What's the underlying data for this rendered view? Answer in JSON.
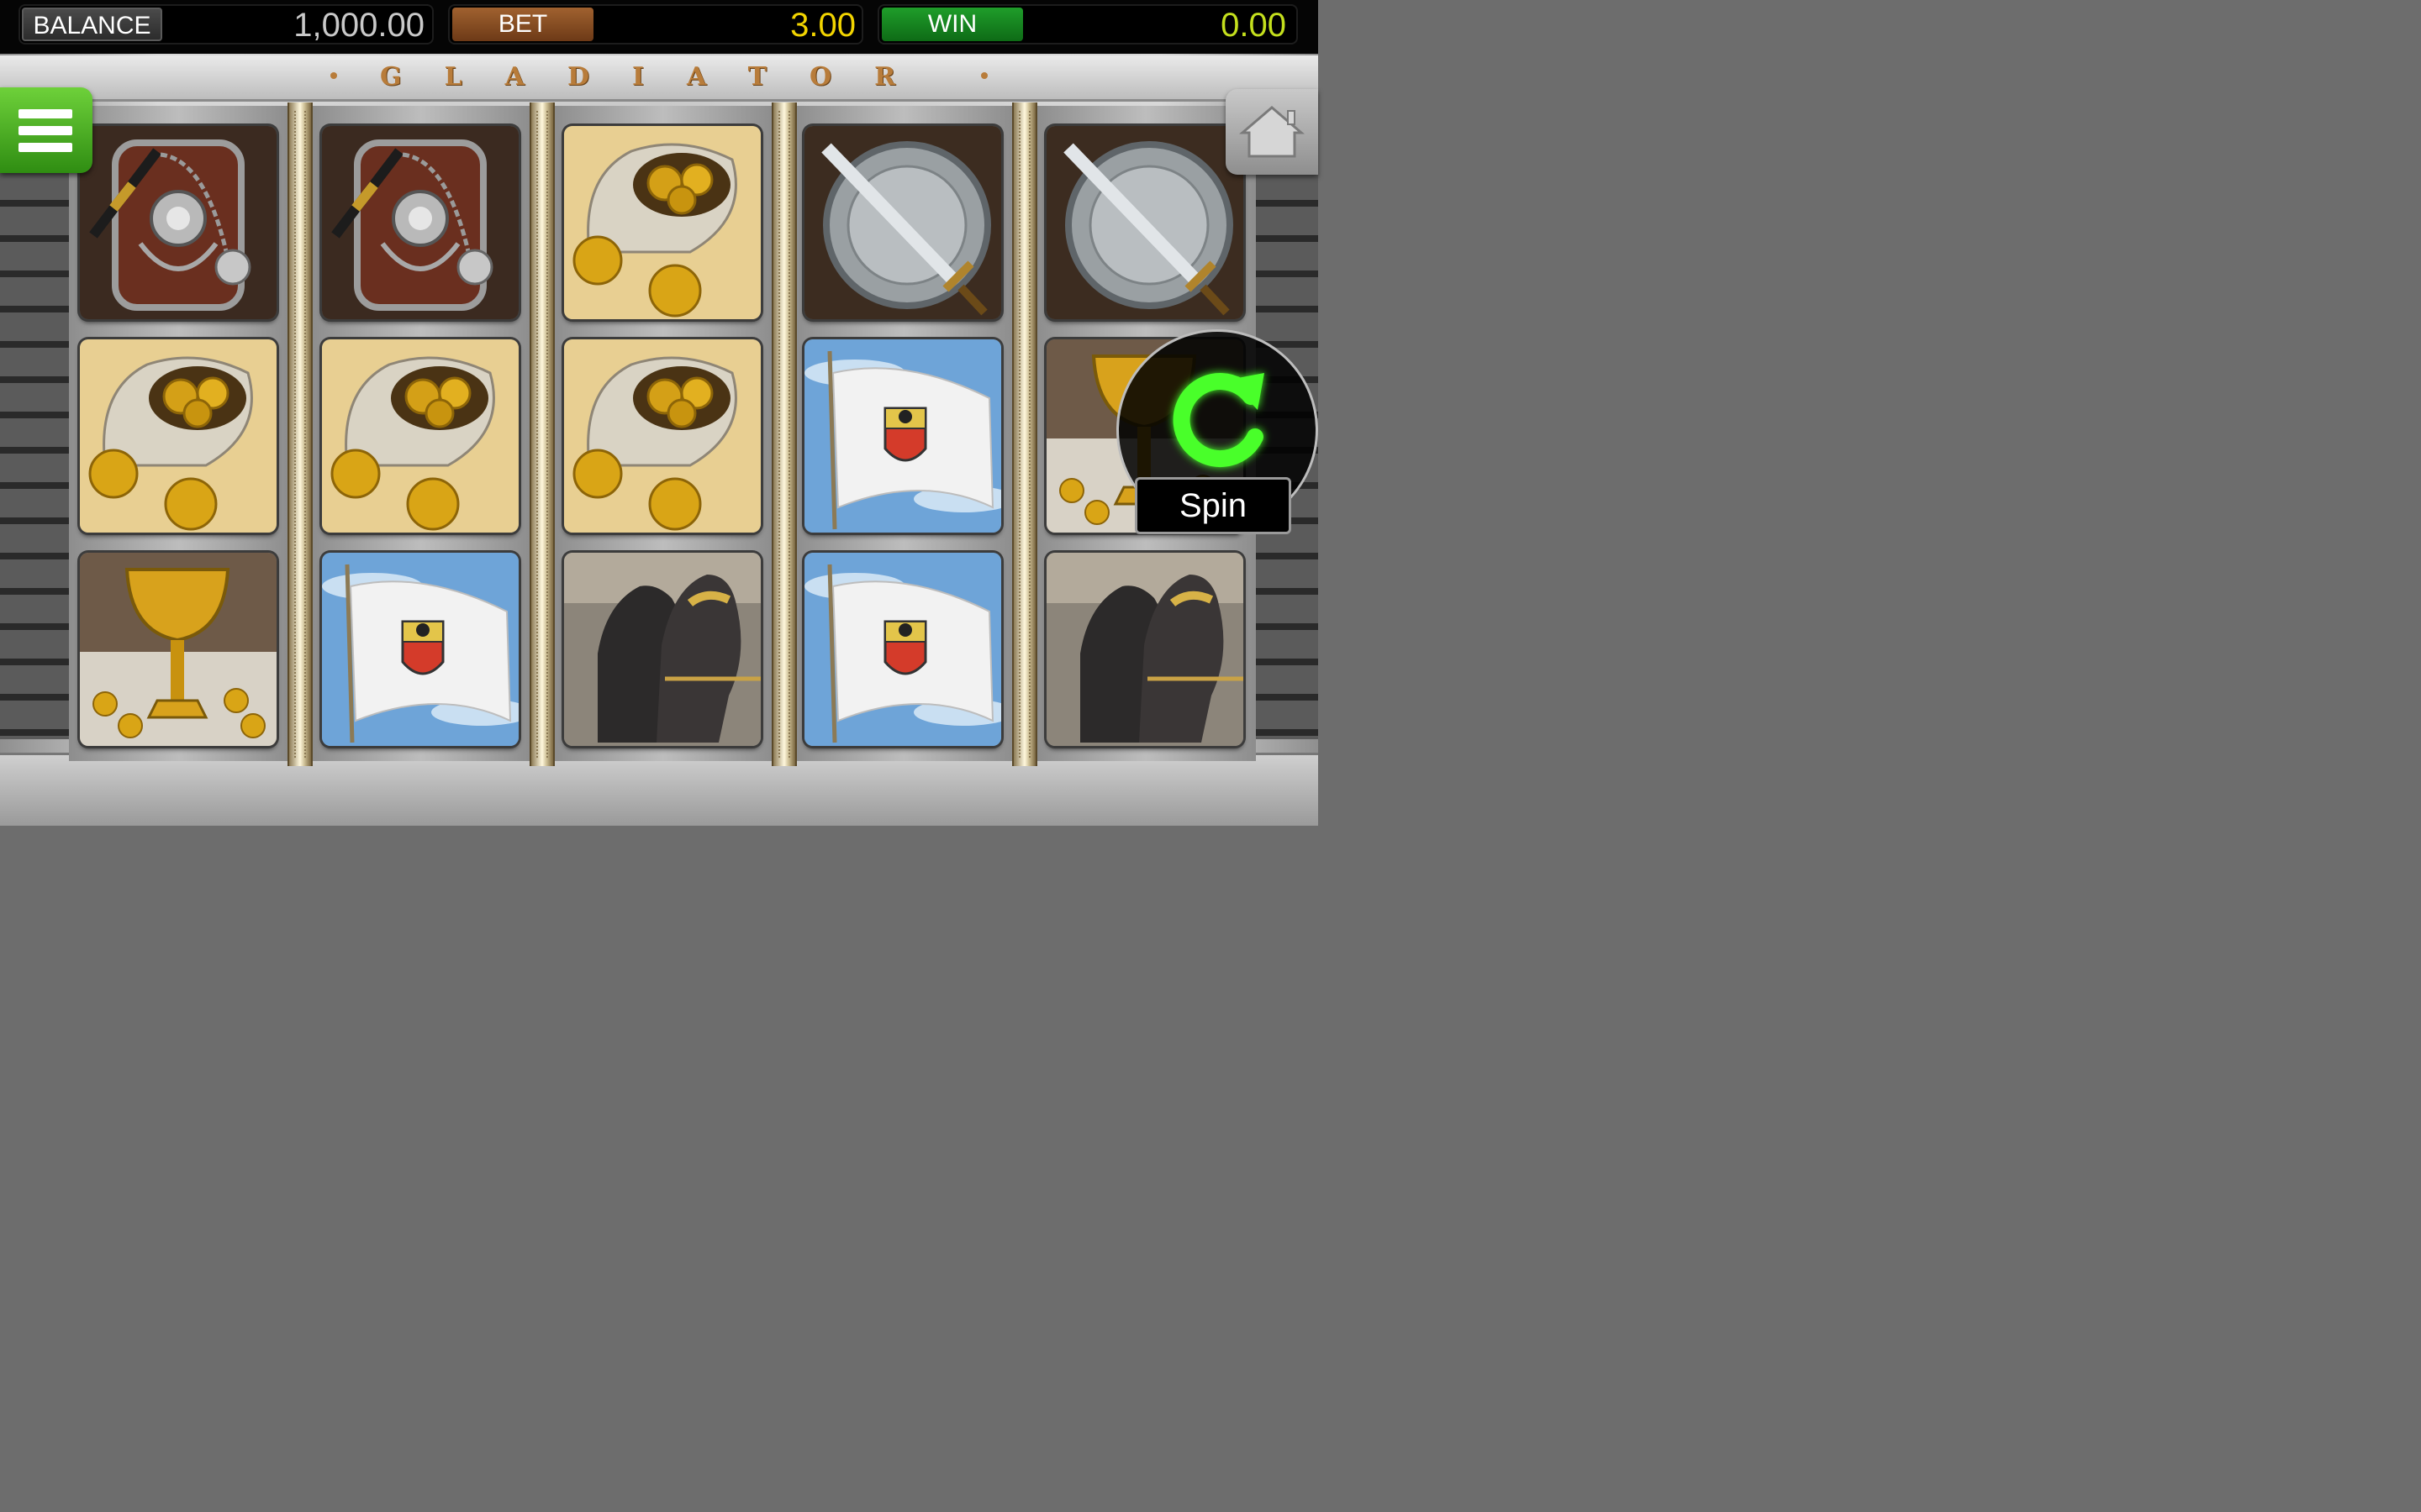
{
  "header": {
    "balance_label": "BALANCE",
    "balance_value": "1,000.00",
    "bet_label": "BET",
    "bet_value": "3.00",
    "win_label": "WIN",
    "win_value": "0.00"
  },
  "game": {
    "title": "GLADIATOR"
  },
  "controls": {
    "menu_icon": "hamburger-icon",
    "home_icon": "home-icon",
    "spin_icon": "spin-arrow-icon",
    "spin_label": "Spin"
  },
  "reels": [
    [
      "shield-flail",
      "coin-bag",
      "golden-chalice"
    ],
    [
      "shield-flail",
      "coin-bag",
      "white-flag"
    ],
    [
      "coin-bag",
      "coin-bag",
      "chariot-horses"
    ],
    [
      "sword-shield",
      "white-flag",
      "white-flag"
    ],
    [
      "sword-shield",
      "golden-chalice",
      "chariot-horses"
    ]
  ],
  "colors": {
    "bet_value": "#f2d400",
    "win_value": "#c4df1d",
    "bet_label_bg": "#8a4e22",
    "win_label_bg": "#178a22",
    "menu_button": "#4caf25",
    "spin_arrow": "#49ff2a"
  }
}
